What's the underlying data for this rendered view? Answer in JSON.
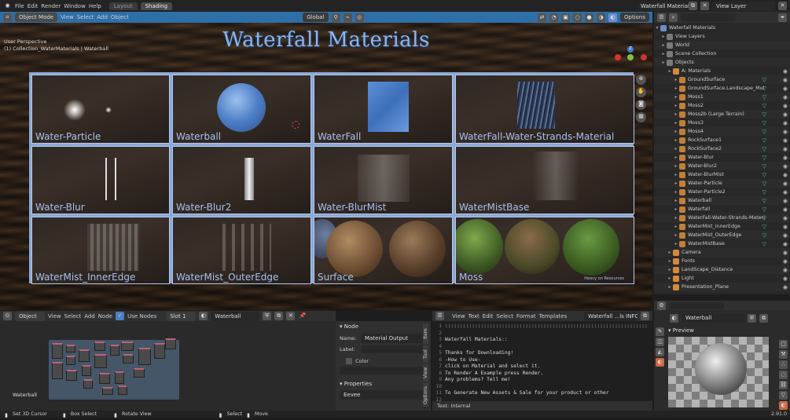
{
  "topbar": {
    "menus": [
      "File",
      "Edit",
      "Render",
      "Window",
      "Help"
    ],
    "tabs": [
      "Layout",
      "Shading"
    ],
    "scene": "Waterfall Materials",
    "view_layer": "View Layer"
  },
  "viewport": {
    "mode": "Object Mode",
    "menus": [
      "View",
      "Select",
      "Add",
      "Object"
    ],
    "orientation": "Global",
    "options": "Options",
    "perspective": "User Perspective",
    "collection": "(1) Collection_WaterMaterials | Waterball",
    "title": "Waterfall Materials",
    "credit": "Heavy on Resources"
  },
  "cells": [
    "Water-Particle",
    "Waterball",
    "WaterFall",
    "WaterFall-Water-Strands-Material",
    "Water-Blur",
    "Water-Blur2",
    "Water-BlurMist",
    "WaterMistBase",
    "WaterMist_InnerEdge",
    "WaterMist_OuterEdge",
    "Surface",
    "Moss"
  ],
  "outliner": {
    "root": "Waterfall Materials",
    "items": [
      {
        "t": "View Layers",
        "d": 1
      },
      {
        "t": "World",
        "d": 1
      },
      {
        "t": "Scene Collection",
        "d": 1
      },
      {
        "t": "Objects",
        "d": 1
      },
      {
        "t": "A: Materials",
        "d": 2
      },
      {
        "t": "GroundSurface",
        "d": 3
      },
      {
        "t": "GroundSurface.Landscape_Mul",
        "d": 3
      },
      {
        "t": "Moss1",
        "d": 3
      },
      {
        "t": "Moss2",
        "d": 3
      },
      {
        "t": "Moss2b (Large Terrain)",
        "d": 3
      },
      {
        "t": "Moss3",
        "d": 3
      },
      {
        "t": "Moss4",
        "d": 3
      },
      {
        "t": "RockSurface1",
        "d": 3
      },
      {
        "t": "RockSurface2",
        "d": 3
      },
      {
        "t": "Water-Blur",
        "d": 3
      },
      {
        "t": "Water-Blur2",
        "d": 3
      },
      {
        "t": "Water-BlurMist",
        "d": 3
      },
      {
        "t": "Water-Particle",
        "d": 3
      },
      {
        "t": "Water-Particle2",
        "d": 3
      },
      {
        "t": "Waterball",
        "d": 3
      },
      {
        "t": "Waterfall",
        "d": 3
      },
      {
        "t": "WaterFall-Water-Strands-Materi",
        "d": 3
      },
      {
        "t": "WaterMist_InnerEdge",
        "d": 3
      },
      {
        "t": "WaterMist_OuterEdge",
        "d": 3
      },
      {
        "t": "WaterMistBase",
        "d": 3
      },
      {
        "t": "Camera",
        "d": 2
      },
      {
        "t": "Fonts",
        "d": 2
      },
      {
        "t": "LandScape_Distance",
        "d": 2
      },
      {
        "t": "Light",
        "d": 2
      },
      {
        "t": "Presentation_Plane",
        "d": 2
      }
    ]
  },
  "node_editor": {
    "type": "Object",
    "menus": [
      "View",
      "Select",
      "Add",
      "Node"
    ],
    "use_nodes": "Use Nodes",
    "slot": "Slot 1",
    "material": "Waterball",
    "label": "Waterball"
  },
  "sidebar": {
    "section": "Node",
    "name_label": "Name:",
    "name_value": "Material Output",
    "label_label": "Label:",
    "color": "Color",
    "properties": "Properties",
    "target": "Eevee",
    "tabs": [
      "Item",
      "Tool",
      "View",
      "Options"
    ]
  },
  "text_editor": {
    "menus": [
      "View",
      "Text",
      "Edit",
      "Select",
      "Format",
      "Templates"
    ],
    "file": "Waterfall ...ls INFO.txt",
    "footer": "Text: Internal",
    "lines": [
      {
        "n": "1",
        "t": "::::::::::::::::::::::::::::::::::::::::::::::::::::::::::::::::::::"
      },
      {
        "n": "2",
        "t": ""
      },
      {
        "n": "3",
        "t": "Waterfall Materials::"
      },
      {
        "n": "4",
        "t": ""
      },
      {
        "n": "5",
        "t": "Thanks for Downloading!"
      },
      {
        "n": "6",
        "t": "-How to Use-"
      },
      {
        "n": "7",
        "t": "click on Material and select it."
      },
      {
        "n": "8",
        "t": "To Render A Example press Render."
      },
      {
        "n": "9",
        "t": "Any problems? Tell me!"
      },
      {
        "n": "10",
        "t": ""
      },
      {
        "n": "11",
        "t": "To Generate New Assets & Sale for your product or other"
      },
      {
        "n": "12",
        "t": ""
      }
    ]
  },
  "properties": {
    "material": "Waterball",
    "preview": "Preview"
  },
  "status": {
    "items": [
      "Set 3D Cursor",
      "Box Select",
      "Rotate View",
      "Select",
      "Move"
    ],
    "version": "2.91.0"
  }
}
